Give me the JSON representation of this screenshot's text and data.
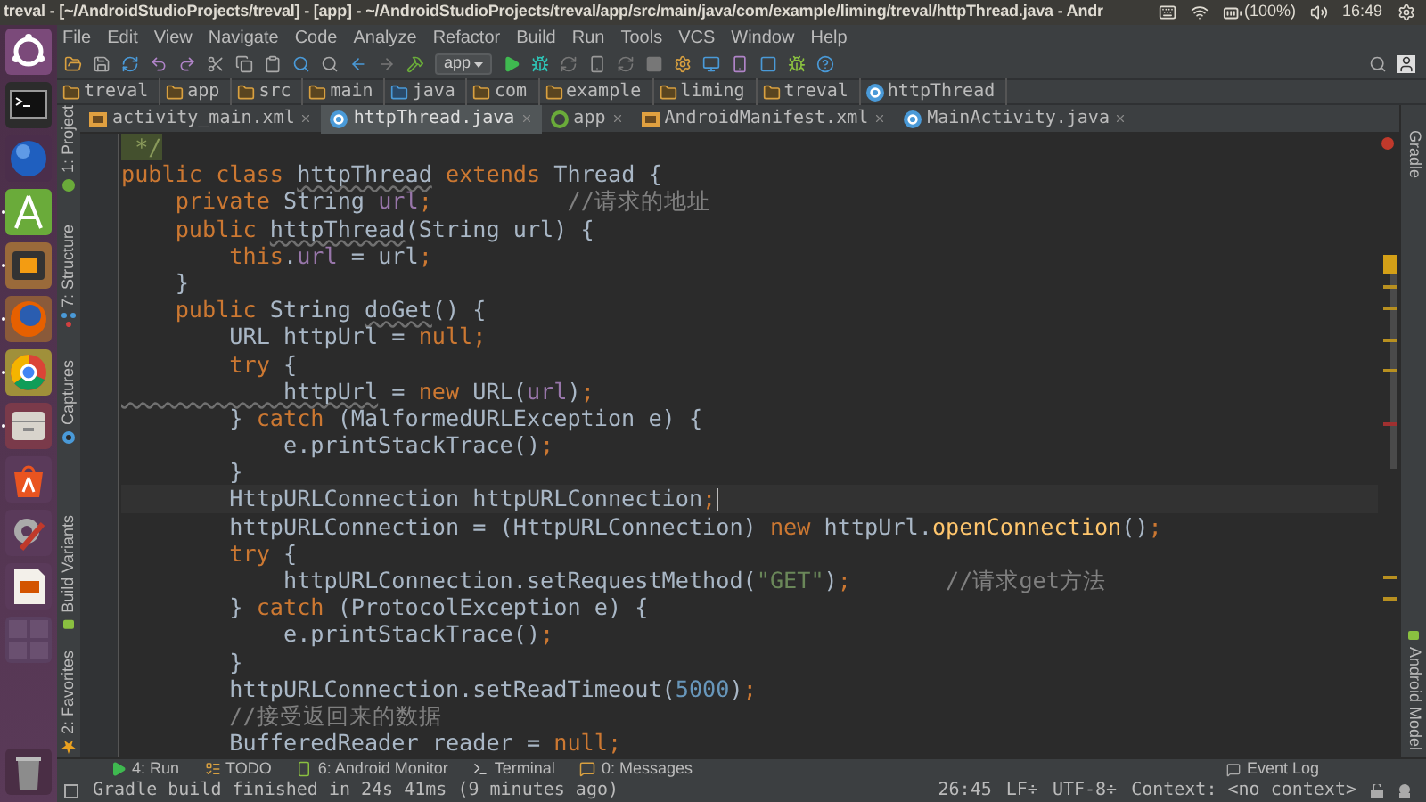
{
  "top_panel": {
    "title": "treval - [~/AndroidStudioProjects/treval] - [app] - ~/AndroidStudioProjects/treval/app/src/main/java/com/example/liming/treval/httpThread.java - Andr",
    "battery": "(100%)",
    "clock": "16:49"
  },
  "launcher": [
    {
      "kind": "dash",
      "running": false
    },
    {
      "kind": "terminal",
      "running": false
    },
    {
      "kind": "sphere",
      "running": false
    },
    {
      "kind": "studio",
      "running": true
    },
    {
      "kind": "editor",
      "running": true
    },
    {
      "kind": "firefox",
      "running": true
    },
    {
      "kind": "chrome",
      "running": true
    },
    {
      "kind": "archive",
      "running": true
    },
    {
      "kind": "store",
      "running": false
    },
    {
      "kind": "settings",
      "running": false
    },
    {
      "kind": "presentation",
      "running": false
    },
    {
      "kind": "workspace",
      "running": false
    },
    {
      "kind": "trash",
      "running": false
    }
  ],
  "menu": [
    "File",
    "Edit",
    "View",
    "Navigate",
    "Code",
    "Analyze",
    "Refactor",
    "Build",
    "Run",
    "Tools",
    "VCS",
    "Window",
    "Help"
  ],
  "toolbar": {
    "run_config": "app"
  },
  "breadcrumbs": [
    {
      "label": "treval",
      "kind": "project"
    },
    {
      "label": "app",
      "kind": "module"
    },
    {
      "label": "src",
      "kind": "folder"
    },
    {
      "label": "main",
      "kind": "folder"
    },
    {
      "label": "java",
      "kind": "source"
    },
    {
      "label": "com",
      "kind": "package"
    },
    {
      "label": "example",
      "kind": "package"
    },
    {
      "label": "liming",
      "kind": "package"
    },
    {
      "label": "treval",
      "kind": "package"
    },
    {
      "label": "httpThread",
      "kind": "class"
    }
  ],
  "tabs": [
    {
      "label": "activity_main.xml",
      "kind": "xml",
      "selected": false
    },
    {
      "label": "httpThread.java",
      "kind": "class",
      "selected": true
    },
    {
      "label": "app",
      "kind": "gradle",
      "selected": false
    },
    {
      "label": "AndroidManifest.xml",
      "kind": "xml",
      "selected": false
    },
    {
      "label": "MainActivity.java",
      "kind": "class",
      "selected": false
    }
  ],
  "left_tool_windows": [
    {
      "label": "1: Project",
      "kind": "project"
    },
    {
      "label": "7: Structure",
      "kind": "structure"
    },
    {
      "label": "Captures",
      "kind": "captures"
    },
    {
      "label": "Build Variants",
      "kind": "variants"
    },
    {
      "label": "2: Favorites",
      "kind": "favorites"
    }
  ],
  "right_tool_windows": [
    {
      "label": "Gradle",
      "kind": "gradle"
    },
    {
      "label": "Android Model",
      "kind": "android"
    }
  ],
  "code": [
    {
      "current": false,
      "tokens": [
        {
          "kind": "doc",
          "text": " */"
        }
      ]
    },
    {
      "current": false,
      "tokens": [
        {
          "kind": "kw",
          "text": "public class "
        },
        {
          "kind": "unused",
          "text": "httpThread"
        },
        {
          "kind": "kw",
          "text": " extends "
        },
        {
          "kind": "plain",
          "text": "Thread {"
        }
      ]
    },
    {
      "current": false,
      "tokens": [
        {
          "kind": "kw",
          "text": "    private "
        },
        {
          "kind": "plain",
          "text": "String "
        },
        {
          "kind": "field",
          "text": "url"
        },
        {
          "kind": "kw",
          "text": ";"
        },
        {
          "kind": "comment",
          "text": "          //请求的地址"
        }
      ]
    },
    {
      "current": false,
      "tokens": [
        {
          "kind": "kw",
          "text": "    public "
        },
        {
          "kind": "unused",
          "text": "httpThread"
        },
        {
          "kind": "plain",
          "text": "(String url) {"
        }
      ]
    },
    {
      "current": false,
      "tokens": [
        {
          "kind": "kw",
          "text": "        this"
        },
        {
          "kind": "plain",
          "text": "."
        },
        {
          "kind": "field",
          "text": "url"
        },
        {
          "kind": "plain",
          "text": " = url"
        },
        {
          "kind": "kw",
          "text": ";"
        }
      ]
    },
    {
      "current": false,
      "tokens": [
        {
          "kind": "plain",
          "text": "    }"
        }
      ]
    },
    {
      "current": false,
      "tokens": [
        {
          "kind": "kw",
          "text": "    public "
        },
        {
          "kind": "plain",
          "text": "String "
        },
        {
          "kind": "unused",
          "text": "doGet"
        },
        {
          "kind": "plain",
          "text": "() {"
        }
      ]
    },
    {
      "current": false,
      "tokens": [
        {
          "kind": "plain",
          "text": "        URL httpUrl = "
        },
        {
          "kind": "kw",
          "text": "null;"
        }
      ]
    },
    {
      "current": false,
      "tokens": [
        {
          "kind": "kw",
          "text": "        try "
        },
        {
          "kind": "plain",
          "text": "{"
        }
      ]
    },
    {
      "current": false,
      "tokens": [
        {
          "kind": "unused",
          "text": "            httpUrl"
        },
        {
          "kind": "plain",
          "text": " = "
        },
        {
          "kind": "kw",
          "text": "new "
        },
        {
          "kind": "plain",
          "text": "URL("
        },
        {
          "kind": "field",
          "text": "url"
        },
        {
          "kind": "plain",
          "text": ")"
        },
        {
          "kind": "kw",
          "text": ";"
        }
      ]
    },
    {
      "current": false,
      "tokens": [
        {
          "kind": "plain",
          "text": "        } "
        },
        {
          "kind": "kw",
          "text": "catch "
        },
        {
          "kind": "plain",
          "text": "(MalformedURLException e) {"
        }
      ]
    },
    {
      "current": false,
      "tokens": [
        {
          "kind": "plain",
          "text": "            e.printStackTrace()"
        },
        {
          "kind": "kw",
          "text": ";"
        }
      ]
    },
    {
      "current": false,
      "tokens": [
        {
          "kind": "plain",
          "text": "        }"
        }
      ]
    },
    {
      "current": true,
      "tokens": [
        {
          "kind": "plain",
          "text": "        HttpURLConnection httpURLConnection"
        },
        {
          "kind": "kw",
          "text": ";"
        }
      ]
    },
    {
      "current": false,
      "tokens": [
        {
          "kind": "plain",
          "text": "        httpURLConnection = (HttpURLConnection) "
        },
        {
          "kind": "kw",
          "text": "new "
        },
        {
          "kind": "plain",
          "text": "httpUrl."
        },
        {
          "kind": "method",
          "text": "openConnection"
        },
        {
          "kind": "plain",
          "text": "()"
        },
        {
          "kind": "kw",
          "text": ";"
        }
      ]
    },
    {
      "current": false,
      "tokens": [
        {
          "kind": "kw",
          "text": "        try "
        },
        {
          "kind": "plain",
          "text": "{"
        }
      ]
    },
    {
      "current": false,
      "tokens": [
        {
          "kind": "plain",
          "text": "            httpURLConnection.setRequestMethod("
        },
        {
          "kind": "str",
          "text": "\"GET\""
        },
        {
          "kind": "plain",
          "text": ")"
        },
        {
          "kind": "kw",
          "text": ";"
        },
        {
          "kind": "comment",
          "text": "       //请求get方法"
        }
      ]
    },
    {
      "current": false,
      "tokens": [
        {
          "kind": "plain",
          "text": "        } "
        },
        {
          "kind": "kw",
          "text": "catch "
        },
        {
          "kind": "plain",
          "text": "(ProtocolException e) {"
        }
      ]
    },
    {
      "current": false,
      "tokens": [
        {
          "kind": "plain",
          "text": "            e.printStackTrace()"
        },
        {
          "kind": "kw",
          "text": ";"
        }
      ]
    },
    {
      "current": false,
      "tokens": [
        {
          "kind": "plain",
          "text": "        }"
        }
      ]
    },
    {
      "current": false,
      "tokens": [
        {
          "kind": "plain",
          "text": "        httpURLConnection.setReadTimeout("
        },
        {
          "kind": "num",
          "text": "5000"
        },
        {
          "kind": "plain",
          "text": ")"
        },
        {
          "kind": "kw",
          "text": ";"
        }
      ]
    },
    {
      "current": false,
      "tokens": [
        {
          "kind": "comment",
          "text": "        //接受返回来的数据"
        }
      ]
    },
    {
      "current": false,
      "tokens": [
        {
          "kind": "plain",
          "text": "        BufferedReader reader = "
        },
        {
          "kind": "kw",
          "text": "null;"
        }
      ]
    }
  ],
  "bottom_tools": [
    {
      "label": "4: Run",
      "kind": "run"
    },
    {
      "label": "TODO",
      "kind": "todo"
    },
    {
      "label": "6: Android Monitor",
      "kind": "monitor"
    },
    {
      "label": "Terminal",
      "kind": "terminal"
    },
    {
      "label": "0: Messages",
      "kind": "messages"
    }
  ],
  "event_log": "Event Log",
  "status": {
    "message": "Gradle build finished in 24s 41ms (9 minutes ago)",
    "position": "26:45",
    "line_separator": "LF÷",
    "encoding": "UTF-8÷",
    "context": "Context: <no context>"
  }
}
